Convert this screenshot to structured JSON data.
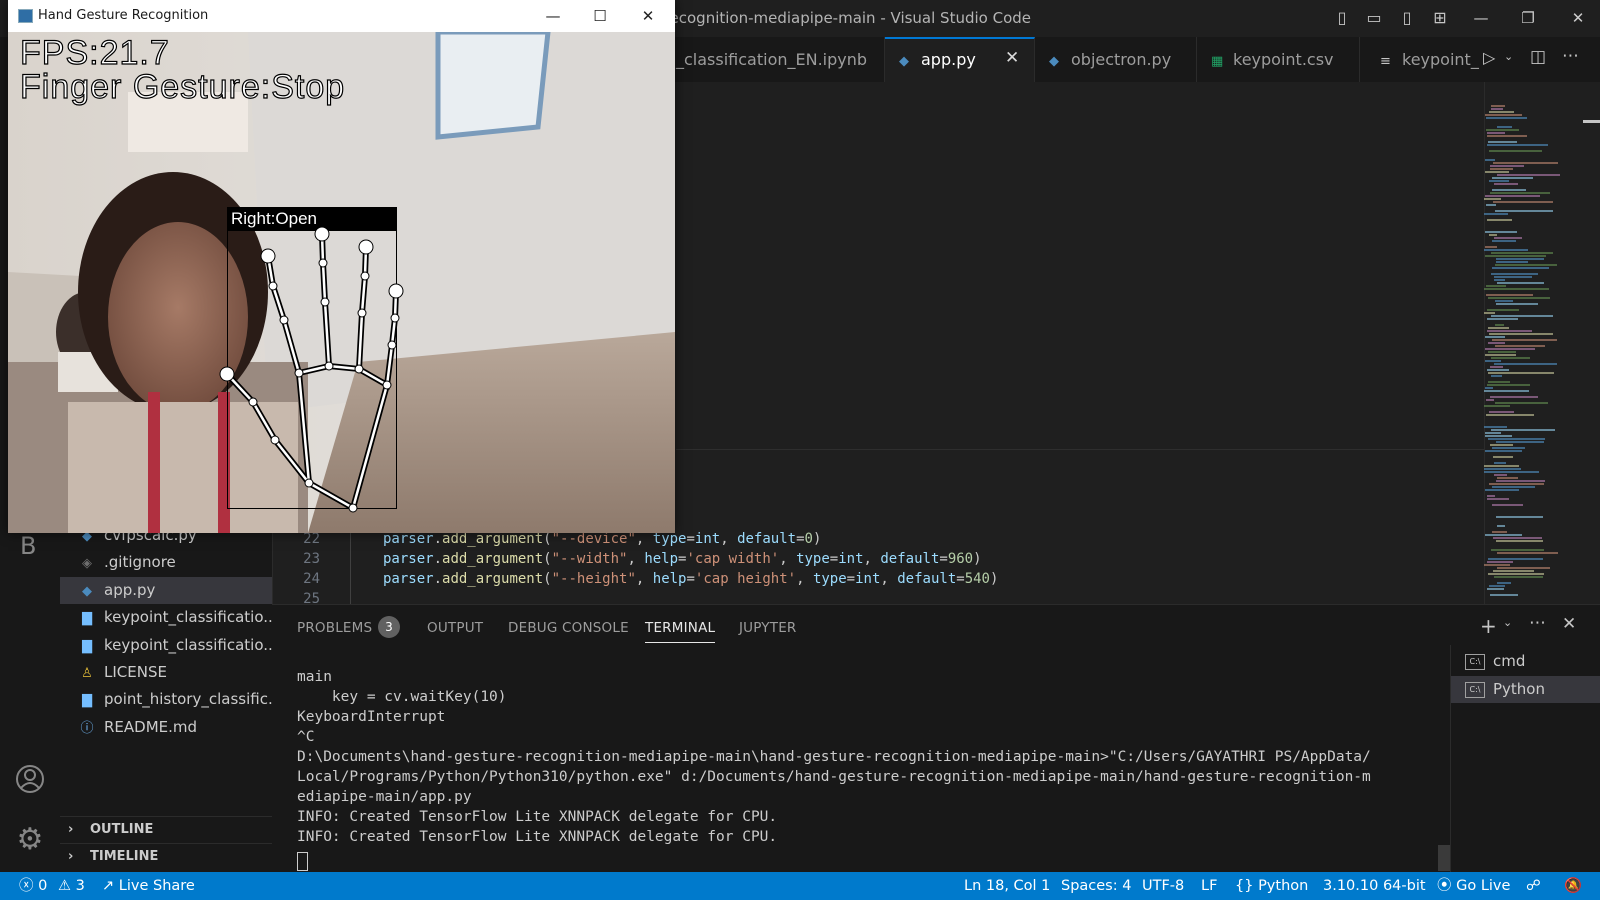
{
  "window": {
    "title": "sture-recognition-mediapipe-main - Visual Studio Code"
  },
  "tabs": [
    {
      "label": "_classification_EN.ipynb",
      "icon": "notebook-icon",
      "active": false
    },
    {
      "label": "app.py",
      "icon": "python-icon",
      "active": true
    },
    {
      "label": "objectron.py",
      "icon": "python-icon",
      "active": false
    },
    {
      "label": "keypoint.csv",
      "icon": "csv-icon",
      "active": false
    },
    {
      "label": "keypoint_",
      "icon": "text-icon",
      "active": false
    }
  ],
  "tab_close_glyph": "✕",
  "editor": {
    "line_numbers": [
      "22",
      "23",
      "24",
      "25"
    ],
    "lines": [
      "parser.add_argument(\"--device\", type=int, default=0)",
      "parser.add_argument(\"--width\", help='cap width', type=int, default=960)",
      "parser.add_argument(\"--height\", help='cap height', type=int, default=540)",
      ""
    ]
  },
  "sidebar": {
    "activity_letter": "B",
    "items": [
      {
        "label": "cvfpscalc.py",
        "icon": "python-icon",
        "selected": false
      },
      {
        "label": ".gitignore",
        "icon": "git-icon",
        "selected": false
      },
      {
        "label": "app.py",
        "icon": "python-icon",
        "selected": true
      },
      {
        "label": "keypoint_classificatio...",
        "icon": "file-icon",
        "selected": false
      },
      {
        "label": "keypoint_classificatio...",
        "icon": "file-icon",
        "selected": false
      },
      {
        "label": "LICENSE",
        "icon": "license-icon",
        "selected": false
      },
      {
        "label": "point_history_classific...",
        "icon": "file-icon",
        "selected": false
      },
      {
        "label": "README.md",
        "icon": "info-icon",
        "selected": false
      }
    ],
    "sections": [
      "OUTLINE",
      "TIMELINE"
    ]
  },
  "panel": {
    "tabs": [
      "PROBLEMS",
      "OUTPUT",
      "DEBUG CONSOLE",
      "TERMINAL",
      "JUPYTER"
    ],
    "active_tab": "TERMINAL",
    "problems_count": "3",
    "terminal_lines": [
      "main",
      "    key = cv.waitKey(10)",
      "KeyboardInterrupt",
      "^C",
      "D:\\Documents\\hand-gesture-recognition-mediapipe-main\\hand-gesture-recognition-mediapipe-main>\"C:/Users/GAYATHRI PS/AppData/",
      "Local/Programs/Python/Python310/python.exe\" d:/Documents/hand-gesture-recognition-mediapipe-main/hand-gesture-recognition-m",
      "ediapipe-main/app.py",
      "INFO: Created TensorFlow Lite XNNPACK delegate for CPU.",
      "INFO: Created TensorFlow Lite XNNPACK delegate for CPU."
    ],
    "terminals": [
      "cmd",
      "Python"
    ],
    "active_terminal": "Python"
  },
  "statusbar": {
    "errors": "0",
    "warnings": "3",
    "live_share": "Live Share",
    "position": "Ln 18, Col 1",
    "spaces": "Spaces: 4",
    "encoding": "UTF-8",
    "eol": "LF",
    "language": "Python",
    "interpreter": "3.10.10 64-bit",
    "go_live": "Go Live"
  },
  "gesture_window": {
    "title": "Hand Gesture Recognition",
    "fps": "FPS:21.7",
    "finger_gesture": "Finger Gesture:Stop",
    "hand_label": "Right:Open"
  },
  "colors": {
    "accent": "#0078d4",
    "statusbar": "#007acc",
    "editor_bg": "#1f1f1f"
  }
}
